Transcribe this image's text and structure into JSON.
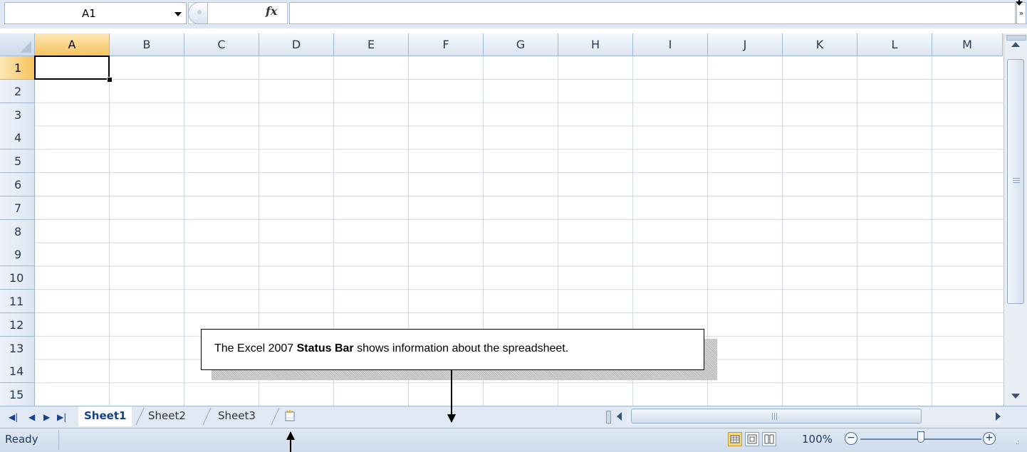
{
  "formula_bar": {
    "name_box_value": "A1",
    "fx_label": "fx",
    "formula_value": ""
  },
  "grid": {
    "columns": [
      "A",
      "B",
      "C",
      "D",
      "E",
      "F",
      "G",
      "H",
      "I",
      "J",
      "K",
      "L",
      "M"
    ],
    "rows": [
      "1",
      "2",
      "3",
      "4",
      "5",
      "6",
      "7",
      "8",
      "9",
      "10",
      "11",
      "12",
      "13",
      "14",
      "15"
    ],
    "active_cell": "A1"
  },
  "sheet_tabs": {
    "tabs": [
      "Sheet1",
      "Sheet2",
      "Sheet3"
    ],
    "active": "Sheet1",
    "nav_buttons": [
      "first",
      "prev",
      "next",
      "last"
    ]
  },
  "status_bar": {
    "status": "Ready",
    "zoom": "100%",
    "zoom_level_percent": 100,
    "views": [
      "normal",
      "page-layout",
      "page-break-preview"
    ],
    "active_view": "normal"
  },
  "callout": {
    "text_before": "The Excel 2007 ",
    "text_bold": "Status Bar",
    "text_after": " shows information about the spreadsheet."
  },
  "colors": {
    "header_bg": "#dbe5f1",
    "active_header": "#f7c35f",
    "gridline": "#d0d7e5",
    "status_text": "#1e395b"
  }
}
